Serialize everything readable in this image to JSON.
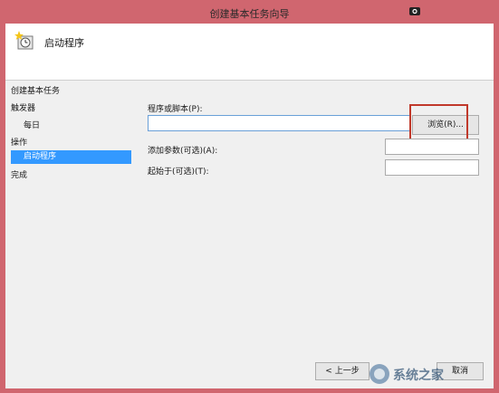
{
  "window": {
    "title": "创建基本任务向导"
  },
  "header": {
    "title": "启动程序"
  },
  "nav": {
    "items": [
      {
        "label": "创建基本任务"
      },
      {
        "label": "触发器"
      },
      {
        "label": "每日"
      },
      {
        "label": "操作"
      },
      {
        "label": "启动程序"
      },
      {
        "label": "完成"
      }
    ]
  },
  "form": {
    "program_label": "程序或脚本(P):",
    "program_value": "",
    "browse_label": "浏览(R)...",
    "args_label": "添加参数(可选)(A):",
    "args_value": "",
    "startin_label": "起始于(可选)(T):",
    "startin_value": ""
  },
  "footer": {
    "back_label": "< 上一步",
    "cancel_label": "取消"
  },
  "watermark": {
    "text": "系统之家"
  },
  "colors": {
    "window_frame": "#d0666f",
    "selection": "#3399ff",
    "highlight_box": "#c0392b"
  }
}
